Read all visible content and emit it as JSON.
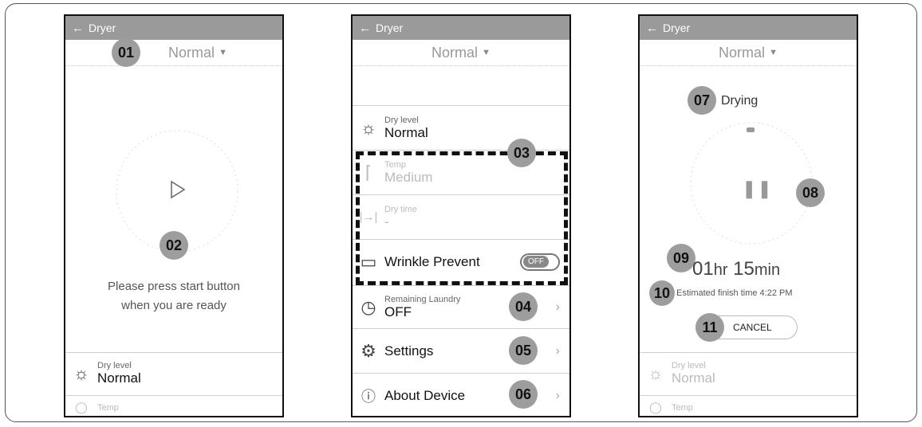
{
  "screens": [
    {
      "title": "Dryer",
      "mode": "Normal",
      "start_message_line1": "Please press start button",
      "start_message_line2": "when you are ready",
      "dry_level_label": "Dry level",
      "dry_level_value": "Normal",
      "temp_label": "Temp"
    },
    {
      "title": "Dryer",
      "mode": "Normal",
      "rows": {
        "dry_level_label": "Dry level",
        "dry_level_value": "Normal",
        "temp_label": "Temp",
        "temp_value": "Medium",
        "dry_time_label": "Dry time",
        "dry_time_value": "-",
        "wrinkle_label": "Wrinkle Prevent",
        "wrinkle_toggle": "OFF",
        "remaining_label": "Remaining Laundry",
        "remaining_value": "OFF",
        "settings_label": "Settings",
        "about_label": "About Device"
      }
    },
    {
      "title": "Dryer",
      "mode": "Normal",
      "status": "Drying",
      "time_hours": "01",
      "time_hr_unit": "hr",
      "time_minutes": "15",
      "time_min_unit": "min",
      "estimated_finish": "Estimated finish time 4:22 PM",
      "cancel_label": "CANCEL",
      "dry_level_label": "Dry level",
      "dry_level_value": "Normal",
      "temp_label": "Temp"
    }
  ],
  "callouts": [
    "01",
    "02",
    "03",
    "04",
    "05",
    "06",
    "07",
    "08",
    "09",
    "10",
    "11"
  ],
  "icons": {
    "back": "back-arrow-icon",
    "caret": "caret-down-icon",
    "play": "play-icon",
    "pause": "pause-icon",
    "sun": "sun-icon",
    "thermometer": "thermometer-icon",
    "dry_time": "dry-time-icon",
    "shirt": "shirt-icon",
    "timer": "timer-icon",
    "gear": "gear-icon",
    "info": "info-icon",
    "chevron": "chevron-right-icon"
  },
  "colors": {
    "appbar": "#9a9a9a",
    "badge": "#9d9d9d",
    "text_muted": "#bbbbbb"
  }
}
